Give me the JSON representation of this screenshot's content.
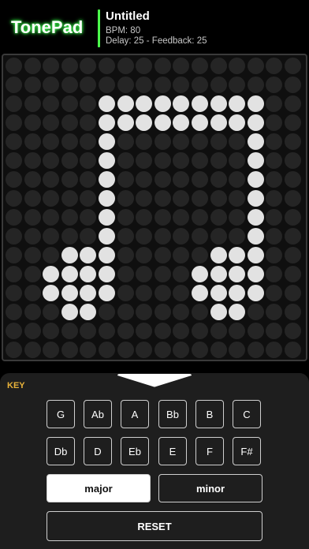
{
  "app": {
    "title": "TonePad"
  },
  "song": {
    "title": "Untitled",
    "bpm_text": "BPM: 80",
    "delay_feedback_text": "Delay: 25 - Feedback: 25"
  },
  "grid": {
    "columns": 16,
    "rows": 16,
    "active_cells": [
      [
        2,
        5
      ],
      [
        2,
        6
      ],
      [
        2,
        7
      ],
      [
        2,
        8
      ],
      [
        2,
        9
      ],
      [
        2,
        10
      ],
      [
        2,
        11
      ],
      [
        2,
        12
      ],
      [
        2,
        13
      ],
      [
        3,
        5
      ],
      [
        3,
        6
      ],
      [
        3,
        7
      ],
      [
        3,
        8
      ],
      [
        3,
        9
      ],
      [
        3,
        10
      ],
      [
        3,
        11
      ],
      [
        3,
        12
      ],
      [
        3,
        13
      ],
      [
        4,
        5
      ],
      [
        4,
        13
      ],
      [
        5,
        5
      ],
      [
        5,
        13
      ],
      [
        6,
        5
      ],
      [
        6,
        13
      ],
      [
        7,
        5
      ],
      [
        7,
        13
      ],
      [
        8,
        5
      ],
      [
        8,
        13
      ],
      [
        9,
        5
      ],
      [
        9,
        13
      ],
      [
        10,
        3
      ],
      [
        10,
        4
      ],
      [
        10,
        5
      ],
      [
        10,
        11
      ],
      [
        10,
        12
      ],
      [
        10,
        13
      ],
      [
        11,
        2
      ],
      [
        11,
        3
      ],
      [
        11,
        4
      ],
      [
        11,
        5
      ],
      [
        11,
        10
      ],
      [
        11,
        11
      ],
      [
        11,
        12
      ],
      [
        11,
        13
      ],
      [
        12,
        2
      ],
      [
        12,
        3
      ],
      [
        12,
        4
      ],
      [
        12,
        5
      ],
      [
        12,
        10
      ],
      [
        12,
        11
      ],
      [
        12,
        12
      ],
      [
        12,
        13
      ],
      [
        13,
        3
      ],
      [
        13,
        4
      ],
      [
        13,
        11
      ],
      [
        13,
        12
      ]
    ],
    "on_color": "#e2e2e2",
    "off_color": "#252525"
  },
  "panel": {
    "key_label": "KEY",
    "key_label_color": "#e8b23a",
    "keys_row1": [
      "G",
      "Ab",
      "A",
      "Bb",
      "B",
      "C"
    ],
    "keys_row2": [
      "Db",
      "D",
      "Eb",
      "E",
      "F",
      "F#"
    ],
    "modes": [
      "major",
      "minor"
    ],
    "selected_mode": "major",
    "reset_label": "RESET",
    "collapse_icon": "chevron-down-icon"
  },
  "accent_color": "#4cff4c"
}
